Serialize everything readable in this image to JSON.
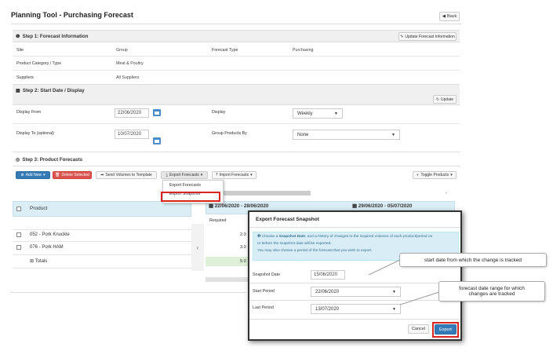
{
  "page": {
    "title": "Planning Tool - Purchasing Forecast",
    "back_label": "Back"
  },
  "step1": {
    "title": "Step 1: Forecast Information",
    "update_button": "Update Forecast Information",
    "fields": {
      "site_label": "Site",
      "site_value": "",
      "group_label": "Group",
      "group_value": "Meat & Poultry",
      "forecast_type_label": "Forecast Type",
      "forecast_type_value": "Purchasing",
      "category_label": "Product Category / Type",
      "category_value": "",
      "suppliers_label": "Suppliers",
      "suppliers_value": "All Suppliers"
    }
  },
  "step2": {
    "title": "Step 2: Start Date / Display",
    "update_button": "Update",
    "display_from_label": "Display From",
    "display_from_value": "22/06/2020",
    "display_label": "Display",
    "display_value": "Weekly",
    "display_to_label": "Display To (optional)",
    "display_to_value": "10/07/2020",
    "group_by_label": "Group Products By",
    "group_by_value": "None"
  },
  "step3": {
    "title": "Step 3: Product Forecasts",
    "toolbar": {
      "add_new": "Add New",
      "delete_selected": "Delete Selected",
      "send_volumes": "Send Volumes to Template",
      "export_forecasts": "Export Forecasts",
      "import_forecasts": "Import Forecasts",
      "toggle_products": "Toggle Products"
    },
    "export_menu": [
      "Export Forecasts",
      "Export Snapshot"
    ],
    "grid": {
      "product_header": "Product",
      "period1": "22/06/2020 - 28/06/2020",
      "period2": "29/06/2020 - 05/07/2020",
      "required_label": "Required",
      "rows": [
        {
          "name": "052 - Pork Knuckle",
          "value": "2.0"
        },
        {
          "name": "076 - Pork HAM",
          "value": "3.0"
        }
      ],
      "totals_label": "Totals",
      "totals_value": "5.0"
    }
  },
  "modal": {
    "title": "Export Forecast Snapshot",
    "info_line1_pre": "Choose a ",
    "info_line1_bold": "Snapshot Date",
    "info_line1_post": ", and a history of changes to the required volumes of each product/period on",
    "info_line2": "or before the snapshot date will be exported.",
    "info_line3": "You may also choose a period of the forecast that you wish to export.",
    "snapshot_label": "Snapshot Date",
    "snapshot_value": "15/06/2020",
    "start_label": "Start Period",
    "start_value": "22/06/2020",
    "last_label": "Last Period",
    "last_value": "13/07/2020",
    "cancel": "Cancel",
    "export": "Export"
  },
  "callouts": {
    "snapshot": "start date from which the change is tracked",
    "range_line1": "forecast date range for which",
    "range_line2": "changes are tracked"
  },
  "colors": {
    "primary": "#337ab7",
    "danger": "#d9534f",
    "highlight": "#d9241f",
    "info_bg": "#d9edf7",
    "grid_head": "#dbeef6"
  }
}
